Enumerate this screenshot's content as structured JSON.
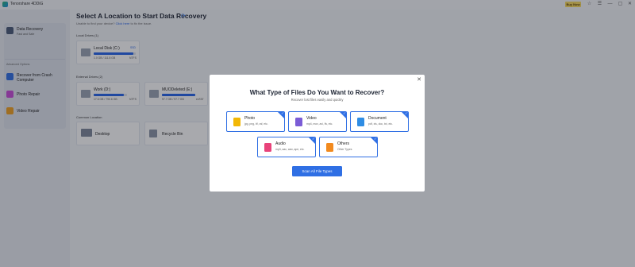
{
  "app": {
    "title": "Tenorshare 4DDiG",
    "buy_label": "Buy Now"
  },
  "window_controls": [
    "☆",
    "☰",
    "—",
    "▢",
    "✕"
  ],
  "sidebar": {
    "items": [
      {
        "label": "Data Recovery",
        "sub": "Fast and Safe",
        "icon": "data-recovery-icon",
        "color": "#4a5a78"
      },
      {
        "label": "Recover from Crash Computer",
        "sub": "",
        "icon": "crash-computer-icon",
        "color": "#2f6fe4"
      },
      {
        "label": "Photo Repair",
        "sub": "",
        "icon": "photo-repair-icon",
        "color": "#c94bd8"
      },
      {
        "label": "Video Repair",
        "sub": "",
        "icon": "video-repair-icon",
        "color": "#f0a020"
      }
    ],
    "advanced_heading": "Advanced Options"
  },
  "main": {
    "title": "Select A Location to Start Data Recovery",
    "help_prefix": "Unable to find your device?",
    "help_link": "Click here",
    "help_suffix": "to fix the issue.",
    "local_heading": "Local Drives (1)",
    "external_heading": "External Drives (2)",
    "common_heading": "Common Location",
    "local_drives": [
      {
        "name": "Local Disk (C:)",
        "size": "1.0 GB / 111.8 GB",
        "fs": "NTFS",
        "badge": "SSD",
        "used_fraction": 0.95
      }
    ],
    "external_drives": [
      {
        "name": "Work (D:)",
        "size": "17.6 GB / 790.6 GB",
        "fs": "NTFS",
        "used_fraction": 0.9
      },
      {
        "name": "MUODeleted (E:)",
        "size": "97.7 GB / 97.7 GB",
        "fs": "exFAT",
        "used_fraction": 1.0
      }
    ],
    "common_locations": [
      {
        "name": "Desktop"
      },
      {
        "name": "Recycle Bin"
      }
    ]
  },
  "modal": {
    "title": "What Type of Files Do You Want to Recover?",
    "subtitle": "Recover lost files easily and quickly",
    "types": [
      {
        "name": "Photo",
        "exts": "jpg, png, tif, raf, etc.",
        "icon": "photo-icon",
        "color": "#f2b705"
      },
      {
        "name": "Video",
        "exts": "mp4, mov, avi, flv, etc.",
        "icon": "video-icon",
        "color": "#7b5cd6"
      },
      {
        "name": "Document",
        "exts": "pdf, xls, doc, txt, etc.",
        "icon": "document-icon",
        "color": "#2f8de4"
      },
      {
        "name": "Audio",
        "exts": "mp3, aac, wav, ape, etc.",
        "icon": "audio-icon",
        "color": "#e8437a"
      },
      {
        "name": "Others",
        "exts": "Other Types",
        "icon": "others-icon",
        "color": "#f28a1e"
      }
    ],
    "scan_label": "Scan All File Types",
    "close_label": "✕"
  },
  "colors": {
    "accent": "#2f6fe4",
    "buy": "#f7d95c"
  }
}
